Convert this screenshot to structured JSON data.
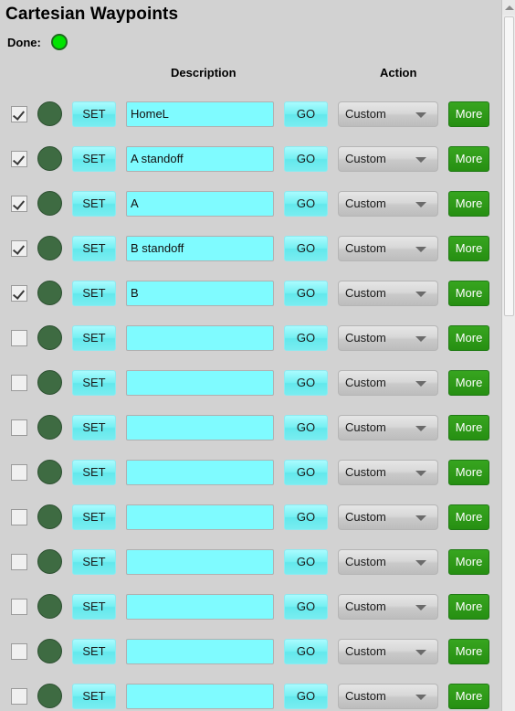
{
  "window": {
    "title": "Cartesian Waypoints"
  },
  "status": {
    "label": "Done:",
    "led_color": "#00e400",
    "led_name": "done-indicator"
  },
  "headers": {
    "description": "Description",
    "action": "Action"
  },
  "row_controls": {
    "set_label": "SET",
    "go_label": "GO",
    "more_label": "More",
    "action_default": "Custom",
    "description_placeholder": ""
  },
  "colors": {
    "background": "#d2d2d2",
    "cyan_button": "#76f0f2",
    "description_field": "#7ffbff",
    "more_button": "#2f9a19",
    "row_led": "#3e6b42"
  },
  "rows": [
    {
      "enabled": true,
      "description": "HomeL",
      "action": "Custom"
    },
    {
      "enabled": true,
      "description": "A standoff",
      "action": "Custom"
    },
    {
      "enabled": true,
      "description": "A",
      "action": "Custom"
    },
    {
      "enabled": true,
      "description": "B standoff",
      "action": "Custom"
    },
    {
      "enabled": true,
      "description": "B",
      "action": "Custom"
    },
    {
      "enabled": false,
      "description": "",
      "action": "Custom"
    },
    {
      "enabled": false,
      "description": "",
      "action": "Custom"
    },
    {
      "enabled": false,
      "description": "",
      "action": "Custom"
    },
    {
      "enabled": false,
      "description": "",
      "action": "Custom"
    },
    {
      "enabled": false,
      "description": "",
      "action": "Custom"
    },
    {
      "enabled": false,
      "description": "",
      "action": "Custom"
    },
    {
      "enabled": false,
      "description": "",
      "action": "Custom"
    },
    {
      "enabled": false,
      "description": "",
      "action": "Custom"
    },
    {
      "enabled": false,
      "description": "",
      "action": "Custom"
    }
  ],
  "scrollbar": {
    "up_arrow": "scroll-up-arrow",
    "thumb": "scroll-thumb"
  }
}
